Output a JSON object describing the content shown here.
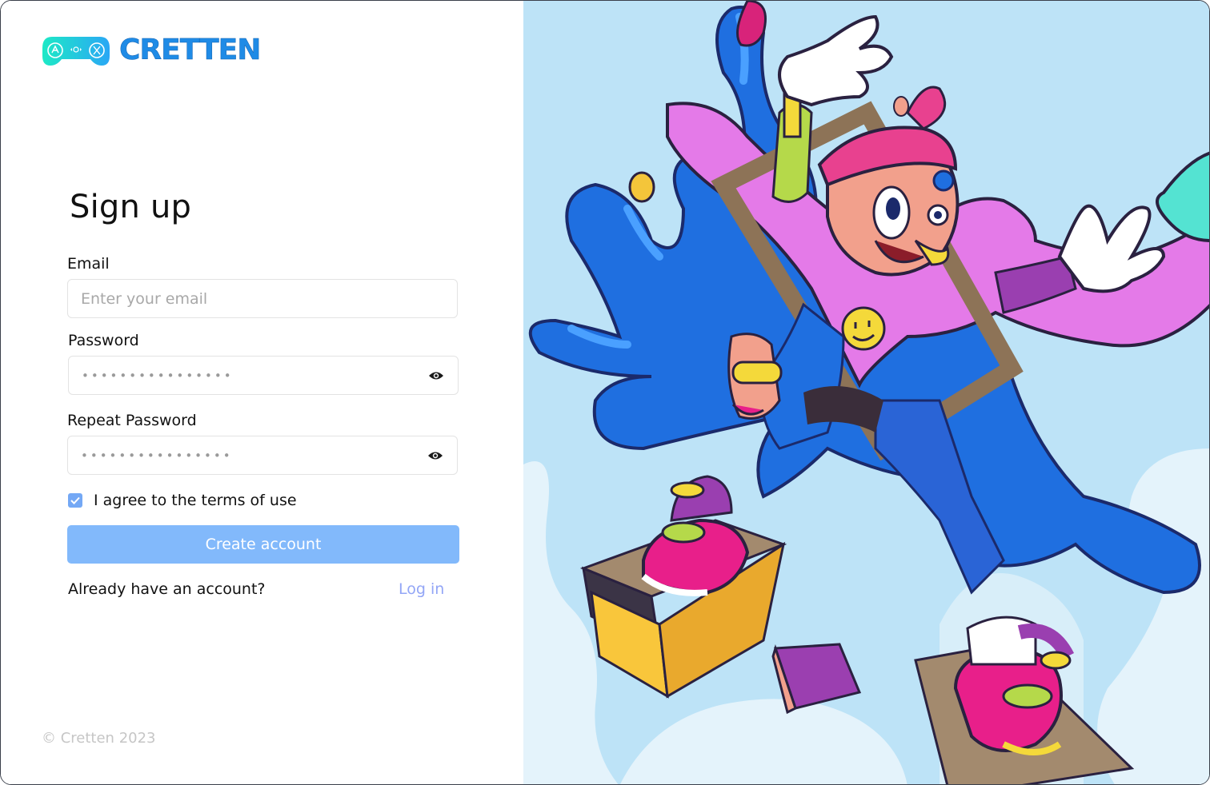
{
  "brand": {
    "name": "CRETTEN",
    "logo_icon": "gamepad-icon",
    "primary_color": "#1f8be6",
    "logo_gradient": [
      "#1de9c6",
      "#2aa7f5"
    ]
  },
  "form": {
    "title": "Sign up",
    "email": {
      "label": "Email",
      "placeholder": "Enter your email",
      "value": ""
    },
    "password": {
      "label": "Password",
      "masked_value": "••••••••••••••••",
      "toggle_icon": "eye-icon"
    },
    "repeat_password": {
      "label": "Repeat Password",
      "masked_value": "••••••••••••••••",
      "toggle_icon": "eye-icon"
    },
    "terms": {
      "label": "I agree to the terms of use",
      "checked": true,
      "color": "#74a8f5"
    },
    "submit_label": "Create account",
    "submit_color": "#82b9fb",
    "login_prompt": "Already have an account?",
    "login_link": "Log in",
    "login_link_color": "#93a6f6"
  },
  "footer": {
    "copyright": "© Cretten 2023"
  },
  "illustration": {
    "name": "paint-splash-character-illustration",
    "background_color": "#bde3f7"
  }
}
